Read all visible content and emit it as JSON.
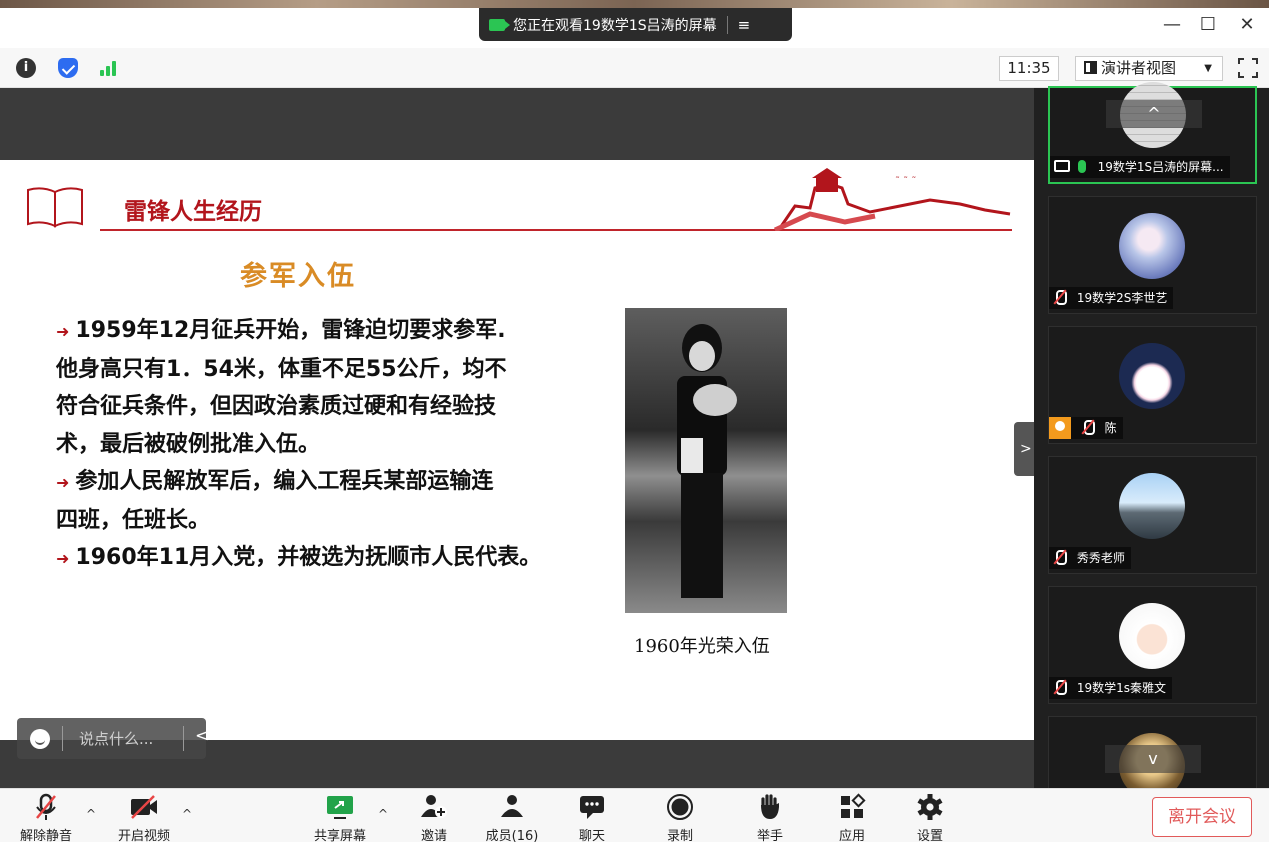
{
  "window": {
    "share_banner": "您正在观看19数学1S吕涛的屏幕",
    "menu_icon": "≡",
    "minimize": "—",
    "maximize": "☐",
    "close": "✕"
  },
  "toolbar": {
    "time": "11:35",
    "view_label": "演讲者视图",
    "view_caret": "▼"
  },
  "slide": {
    "header": "雷锋人生经历",
    "subtitle": "参军入伍",
    "bullets": [
      "1959年12月征兵开始，雷锋迫切要求参军.他身高只有1．54米，体重不足55公斤，均不符合征兵条件，但因政治素质过硬和有经验技术，最后被破例批准入伍。",
      "参加人民解放军后，编入工程兵某部运输连四班，任班长。",
      "1960年11月入党，并被选为抚顺市人民代表。"
    ],
    "bullet_lines": [
      [
        "1959年12月征兵开始，雷锋迫切要求参军.",
        "他身高只有1．54米，体重不足55公斤，均不",
        "符合征兵条件，但因政治素质过硬和有经验技",
        "术，最后被破例批准入伍。"
      ],
      [
        "参加人民解放军后，编入工程兵某部运输连",
        "四班，任班长。"
      ],
      [
        "1960年11月入党，并被选为抚顺市人民代表。"
      ]
    ],
    "photo_caption": "1960年光荣入伍"
  },
  "chat": {
    "placeholder": "说点什么...",
    "collapse": "<"
  },
  "panel": {
    "scroll_up": "^",
    "scroll_down": "v",
    "collapse_handle": ">",
    "participants": [
      {
        "name": "19数学1S吕涛的屏幕...",
        "status": "sharing"
      },
      {
        "name": "19数学2S李世艺",
        "status": "muted"
      },
      {
        "name": "陈",
        "status": "muted"
      },
      {
        "name": "秀秀老师",
        "status": "muted"
      },
      {
        "name": "19数学1s秦雅文",
        "status": "muted"
      }
    ]
  },
  "controls": {
    "unmute": "解除静音",
    "video": "开启视频",
    "share": "共享屏幕",
    "invite": "邀请",
    "members": "成员(16)",
    "chat": "聊天",
    "record": "录制",
    "raise_hand": "举手",
    "apps": "应用",
    "settings": "设置",
    "leave": "离开会议",
    "caret": "^"
  },
  "colors": {
    "accent_red": "#b2151c",
    "subtitle_orange": "#d98b25",
    "active_green": "#2bc553",
    "leave_red": "#e15a5a"
  }
}
